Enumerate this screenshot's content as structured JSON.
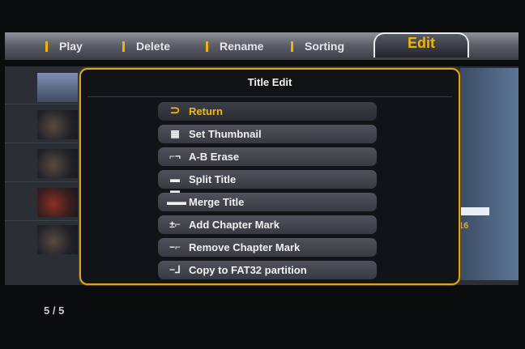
{
  "topbar": {
    "tabs": [
      {
        "label": "Play"
      },
      {
        "label": "Delete"
      },
      {
        "label": "Rename"
      },
      {
        "label": "Sorting"
      },
      {
        "label": "Edit"
      }
    ],
    "active_tab": "Edit",
    "separator_color": "#f0b400"
  },
  "dialog": {
    "title": "Title Edit",
    "items": [
      {
        "label": "Return",
        "icon": "return-arrow-icon",
        "active": true
      },
      {
        "label": "Set Thumbnail",
        "icon": "film-strip-icon",
        "active": false
      },
      {
        "label": "A-B Erase",
        "icon": "ab-erase-icon",
        "active": false
      },
      {
        "label": "Split Title",
        "icon": "split-icon",
        "active": false
      },
      {
        "label": "Merge Title",
        "icon": "merge-icon",
        "active": false
      },
      {
        "label": "Add Chapter Mark",
        "icon": "add-chapter-icon",
        "active": false
      },
      {
        "label": "Remove Chapter Mark",
        "icon": "remove-chapter-icon",
        "active": false
      },
      {
        "label": "Copy to FAT32 partition",
        "icon": "copy-icon",
        "active": false
      }
    ],
    "accent_color": "#d9a51b",
    "highlight_color": "#f6b900"
  },
  "footer": {
    "page_counter": "5 / 5"
  }
}
